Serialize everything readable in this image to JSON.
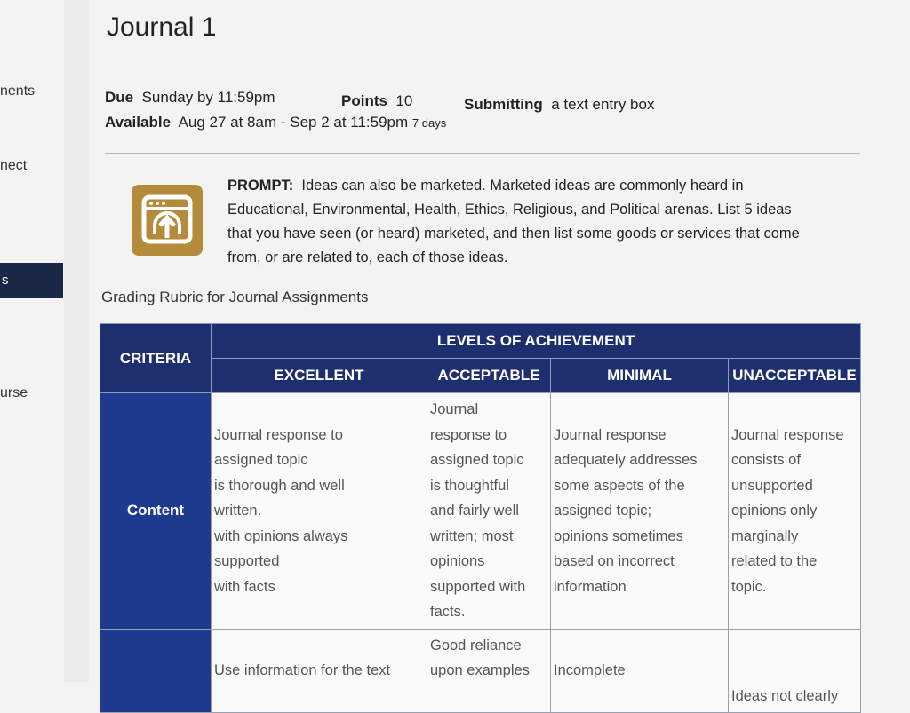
{
  "nav": {
    "fragments": [
      "nents",
      "nect",
      "s",
      "urse"
    ]
  },
  "assignment": {
    "title": "Journal 1",
    "due_label": "Due",
    "due_value": "Sunday by 11:59pm",
    "points_label": "Points",
    "points_value": "10",
    "submitting_label": "Submitting",
    "submitting_value": "a text entry box",
    "available_label": "Available",
    "available_value": "Aug 27 at 8am - Sep 2 at 11:59pm",
    "available_duration": "7 days"
  },
  "prompt": {
    "icon": "upload-window-icon",
    "label": "PROMPT:",
    "lines": [
      "Ideas can also be marketed.  Marketed ideas are commonly heard in",
      "Educational, Environmental, Health, Ethics, Religious, and Political arenas. List 5 ideas",
      "that you have seen (or heard) marketed, and then list some goods or services that come",
      "from, or are related to, each of those ideas."
    ]
  },
  "rubric": {
    "title": "Grading Rubric for Journal Assignments",
    "criteria_header": "CRITERIA",
    "levels_header": "LEVELS OF ACHIEVEMENT",
    "levels": [
      "EXCELLENT",
      "ACCEPTABLE",
      "MINIMAL",
      "UNACCEPTABLE"
    ],
    "rows": [
      {
        "criterion": "Content",
        "cells": [
          [
            "",
            "Journal response to",
            "assigned topic",
            "is thorough and well",
            "written.",
            "with opinions always",
            "supported",
            "with facts"
          ],
          [
            "Journal",
            "response to",
            "assigned topic",
            "is thoughtful",
            "and fairly well",
            "written; most",
            "opinions",
            "supported with",
            "facts."
          ],
          [
            "",
            "Journal response",
            "adequately addresses",
            "some aspects of the",
            "assigned topic;",
            "opinions sometimes",
            "based on incorrect",
            "information"
          ],
          [
            "",
            "Journal response",
            "consists of",
            "unsupported",
            "opinions only",
            "marginally",
            "related to the",
            "topic."
          ]
        ]
      },
      {
        "criterion": "",
        "cells": [
          [
            "",
            "Use information for the text"
          ],
          [
            "Good reliance",
            "upon examples"
          ],
          [
            "",
            "Incomplete"
          ],
          [
            "",
            "",
            "Ideas not clearly"
          ]
        ]
      }
    ]
  },
  "colors": {
    "header_navy": "#1d2f6e",
    "criteria_blue": "#1d3a8f",
    "icon_gold": "#b48a3b",
    "nav_active": "#1b2746"
  }
}
